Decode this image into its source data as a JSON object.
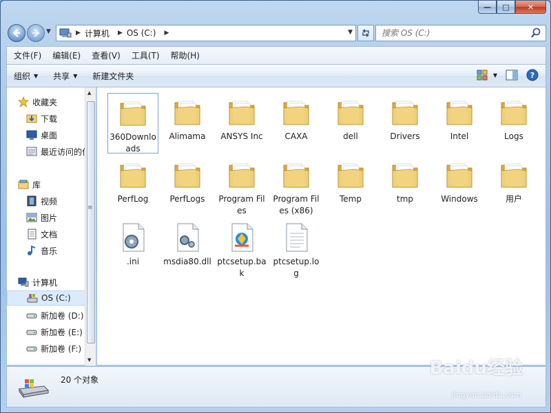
{
  "window": {
    "caption": {
      "minimize": "—",
      "maximize": "□",
      "close": "✕"
    }
  },
  "addressbar": {
    "crumbs": [
      "计算机",
      "OS (C:)"
    ],
    "search_placeholder": "搜索 OS (C:)"
  },
  "menubar": {
    "items": [
      "文件(F)",
      "编辑(E)",
      "查看(V)",
      "工具(T)",
      "帮助(H)"
    ]
  },
  "commandbar": {
    "organize": "组织",
    "share": "共享",
    "new_folder": "新建文件夹"
  },
  "navpane": {
    "favorites": {
      "header": "收藏夹",
      "items": [
        "下载",
        "桌面",
        "最近访问的位置"
      ]
    },
    "libraries": {
      "header": "库",
      "items": [
        "视频",
        "图片",
        "文档",
        "音乐"
      ]
    },
    "computer": {
      "header": "计算机",
      "items": [
        "OS (C:)",
        "新加卷 (D:)",
        "新加卷 (E:)",
        "新加卷 (F:)"
      ]
    }
  },
  "files": [
    {
      "name": "360Downloads",
      "kind": "folder"
    },
    {
      "name": "Alimama",
      "kind": "folder"
    },
    {
      "name": "ANSYS Inc",
      "kind": "folder"
    },
    {
      "name": "CAXA",
      "kind": "folder"
    },
    {
      "name": "dell",
      "kind": "folder"
    },
    {
      "name": "Drivers",
      "kind": "folder"
    },
    {
      "name": "Intel",
      "kind": "folder"
    },
    {
      "name": "Logs",
      "kind": "folder"
    },
    {
      "name": "PerfLog",
      "kind": "folder"
    },
    {
      "name": "PerfLogs",
      "kind": "folder"
    },
    {
      "name": "Program Files",
      "kind": "folder"
    },
    {
      "name": "Program Files (x86)",
      "kind": "folder"
    },
    {
      "name": "Temp",
      "kind": "folder"
    },
    {
      "name": "tmp",
      "kind": "folder"
    },
    {
      "name": "Windows",
      "kind": "folder"
    },
    {
      "name": "用户",
      "kind": "folder"
    },
    {
      "name": ".ini",
      "kind": "settings-file"
    },
    {
      "name": "msdia80.dll",
      "kind": "dll-file"
    },
    {
      "name": "ptcsetup.bak",
      "kind": "setup-file"
    },
    {
      "name": "ptcsetup.log",
      "kind": "text-file"
    }
  ],
  "details": {
    "count": "20 个对象"
  },
  "watermark": {
    "brand": "Baidu经验",
    "url": "jingyan.baidu.com"
  },
  "colors": {
    "folder": "#f2d27a",
    "folder_dark": "#d9ab3f",
    "selection": "#dcebfc"
  }
}
